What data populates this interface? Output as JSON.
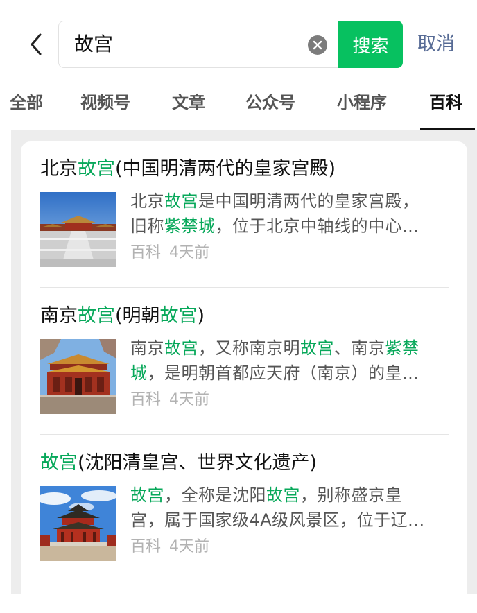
{
  "search": {
    "query": "故宫",
    "search_label": "搜索",
    "cancel_label": "取消"
  },
  "tabs": [
    {
      "label": "全部"
    },
    {
      "label": "视频号"
    },
    {
      "label": "文章"
    },
    {
      "label": "公众号"
    },
    {
      "label": "小程序"
    },
    {
      "label": "百科",
      "active": true
    }
  ],
  "colors": {
    "highlight": "#07a85a",
    "search_button": "#07c160",
    "cancel_link": "#576b95",
    "meta_text": "#b2b2b2"
  },
  "results": [
    {
      "title": {
        "pre": "北京",
        "hl": "故宫",
        "post": "(中国明清两代的皇家宫殿)"
      },
      "line1": {
        "a": "北京",
        "b": "故宫",
        "c": "是中国明清两代的皇家宫殿，"
      },
      "line2": {
        "a": "旧称",
        "b": "紫禁城",
        "c": "，位于北京中轴线的中心..."
      },
      "source": "百科",
      "time": "4天前",
      "thumb_icon": "forbidden-city-photo"
    },
    {
      "title": {
        "pre": "南京",
        "hl": "故宫",
        "mid": "(明朝",
        "hl2": "故宫",
        "post": ")"
      },
      "line1": {
        "a": "南京",
        "b": "故宫",
        "c": "，又称南京明",
        "d": "故宫",
        "e": "、南京",
        "f": "紫禁"
      },
      "line2": {
        "a": "城",
        "b": "，是明朝首都应天府（南京）的皇..."
      },
      "source": "百科",
      "time": "4天前",
      "thumb_icon": "nanjing-palace-photo"
    },
    {
      "title": {
        "hl": "故宫",
        "post": "(沈阳清皇宫、世界文化遗产)"
      },
      "line1": {
        "a": "故宫",
        "b": "，全称是沈阳",
        "c": "故宫",
        "d": "，别称盛京皇"
      },
      "line2": {
        "a": "宫，属于国家级4A级风景区，位于辽..."
      },
      "source": "百科",
      "time": "4天前",
      "thumb_icon": "shenyang-palace-photo"
    }
  ]
}
